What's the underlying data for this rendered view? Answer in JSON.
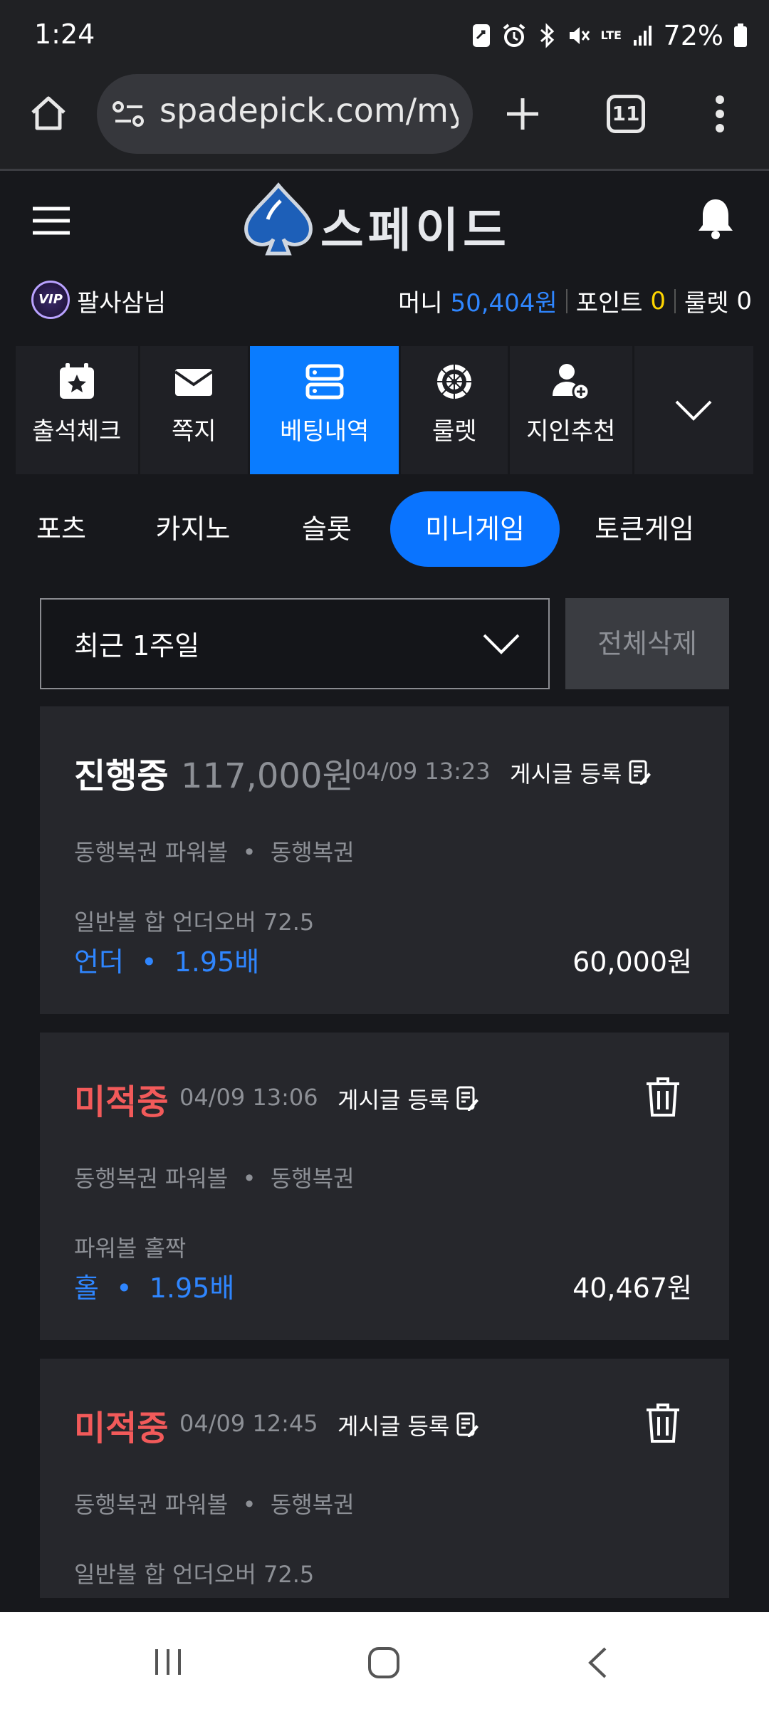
{
  "status_bar": {
    "time": "1:24",
    "battery": "72%",
    "network": "LTE"
  },
  "browser": {
    "url": "spadepick.com/my/l",
    "tab_count": "11"
  },
  "header": {
    "logo": "스페이드"
  },
  "user": {
    "badge": "VIP",
    "name": "팔사삼님",
    "money_label": "머니",
    "money_value": "50,404원",
    "point_label": "포인트",
    "point_value": "0",
    "roulette_label": "룰렛",
    "roulette_value": "0"
  },
  "menu": [
    {
      "label": "출석체크",
      "icon": "calendar-star-icon",
      "active": false
    },
    {
      "label": "쪽지",
      "icon": "envelope-icon",
      "active": false
    },
    {
      "label": "베팅내역",
      "icon": "list-icon",
      "active": true
    },
    {
      "label": "룰렛",
      "icon": "roulette-icon",
      "active": false
    },
    {
      "label": "지인추천",
      "icon": "add-user-icon",
      "active": false
    }
  ],
  "categories": [
    "포츠",
    "카지노",
    "슬롯",
    "미니게임",
    "토큰게임"
  ],
  "active_category": "미니게임",
  "filter": {
    "period": "최근 1주일",
    "delete_all": "전체삭제"
  },
  "colors": {
    "accent": "#0a7cff",
    "pick": "#2f86ff",
    "lost": "#f25a5a",
    "point": "#ffd500"
  },
  "bets": [
    {
      "status": "진행중",
      "amount": "117,000원",
      "date": "04/09 13:23",
      "post_label": "게시글 등록",
      "game": "동행복권 파워볼",
      "provider": "동행복권",
      "market": "일반볼 합 언더오버 72.5",
      "pick": "언더",
      "odds": "1.95배",
      "win": "60,000원"
    },
    {
      "status": "미적중",
      "date": "04/09 13:06",
      "post_label": "게시글 등록",
      "game": "동행복권 파워볼",
      "provider": "동행복권",
      "market": "파워볼 홀짝",
      "pick": "홀",
      "odds": "1.95배",
      "win": "40,467원"
    },
    {
      "status": "미적중",
      "date": "04/09 12:45",
      "post_label": "게시글 등록",
      "game": "동행복권 파워볼",
      "provider": "동행복권",
      "market": "일반볼 합 언더오버 72.5"
    }
  ]
}
